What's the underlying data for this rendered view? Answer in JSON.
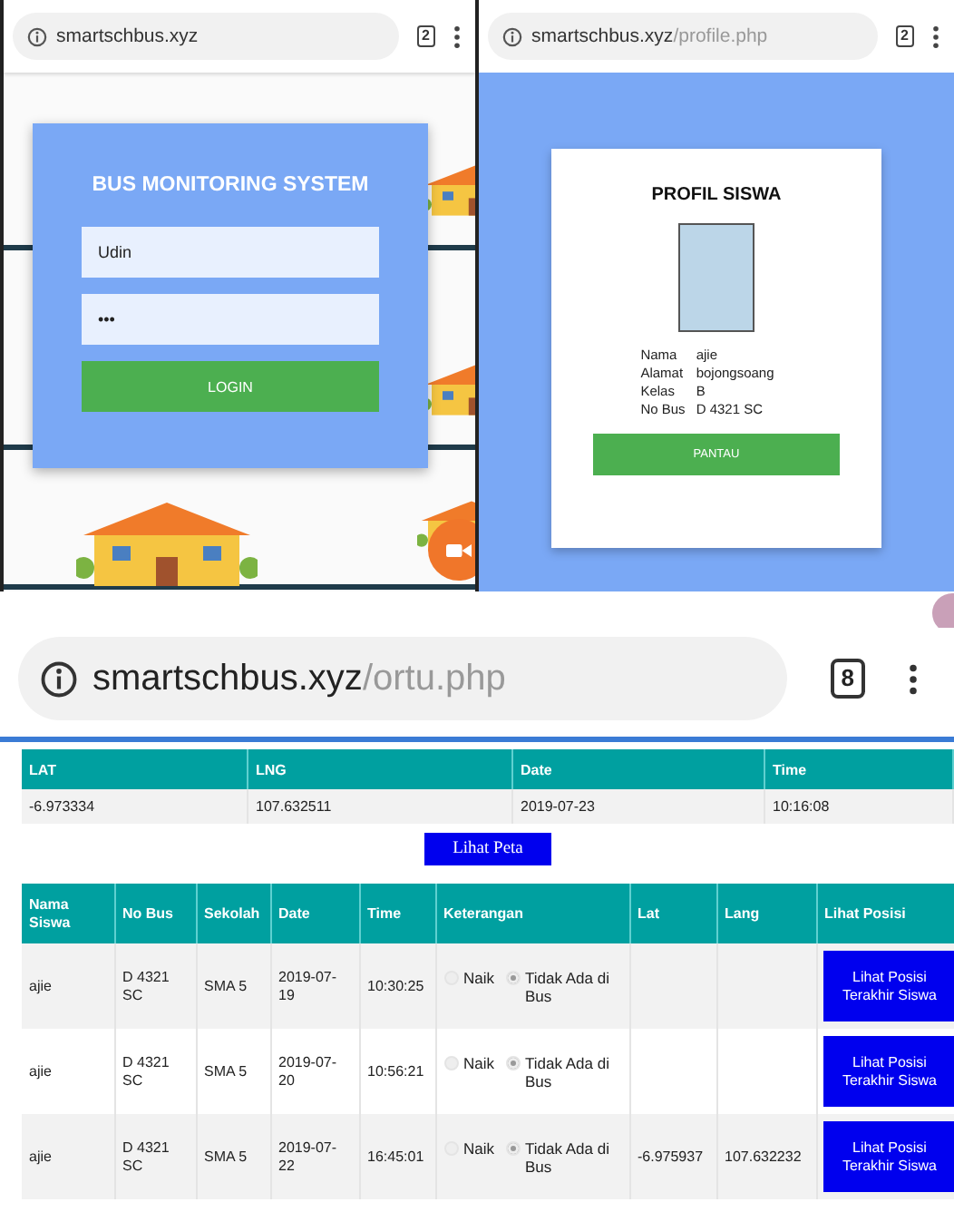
{
  "login_screen": {
    "address_bar": {
      "domain": "smartschbus.xyz",
      "tab_count": "2"
    },
    "title": "BUS MONITORING SYSTEM",
    "username": "Udin",
    "password": "•••",
    "button": "LOGIN"
  },
  "profile_screen": {
    "address_bar": {
      "domain": "smartschbus.xyz",
      "path": "/profile.php",
      "tab_count": "2"
    },
    "title": "PROFIL SISWA",
    "fields": [
      {
        "label": "Nama",
        "value": "ajie"
      },
      {
        "label": "Alamat",
        "value": "bojongsoang"
      },
      {
        "label": "Kelas",
        "value": "B"
      },
      {
        "label": "No Bus",
        "value": "D 4321 SC"
      }
    ],
    "button": "PANTAU"
  },
  "parent_screen": {
    "address_bar": {
      "domain": "smartschbus.xyz",
      "path": "/ortu.php",
      "tab_count": "8"
    },
    "location_table": {
      "columns": [
        "LAT",
        "LNG",
        "Date",
        "Time"
      ],
      "rows": [
        [
          "-6.973334",
          "107.632511",
          "2019-07-23",
          "10:16:08"
        ]
      ]
    },
    "map_button": "Lihat Peta",
    "history_table": {
      "columns": [
        "Nama Siswa",
        "No Bus",
        "Sekolah",
        "Date",
        "Time",
        "Keterangan",
        "Lat",
        "Lang",
        "Lihat Posisi"
      ],
      "rows": [
        {
          "cells": [
            "ajie",
            "D 4321 SC",
            "SMA 5",
            "2019-07-19",
            "10:30:25"
          ],
          "options": [
            {
              "label": "Naik",
              "selected": false
            },
            {
              "label": "Tidak Ada di Bus",
              "selected": true
            }
          ],
          "button": "Lihat Posisi Terakhir Siswa"
        },
        {
          "cells": [
            "ajie",
            "D 4321 SC",
            "SMA 5",
            "2019-07-20",
            "10:56:21"
          ],
          "options": [
            {
              "label": "Naik",
              "selected": false
            },
            {
              "label": "Tidak Ada di Bus",
              "selected": true
            }
          ],
          "button": "Lihat Posisi Terakhir Siswa"
        },
        {
          "cells": [
            "ajie",
            "D 4321 SC",
            "SMA 5",
            "2019-07-22",
            "16:45:01"
          ],
          "options": [
            {
              "label": "Naik",
              "selected": false
            },
            {
              "label": "Tidak Ada di Bus",
              "selected": true
            }
          ],
          "lat": "-6.975937",
          "lng": "107.632232",
          "button": "Lihat Posisi Terakhir Siswa"
        }
      ]
    }
  }
}
